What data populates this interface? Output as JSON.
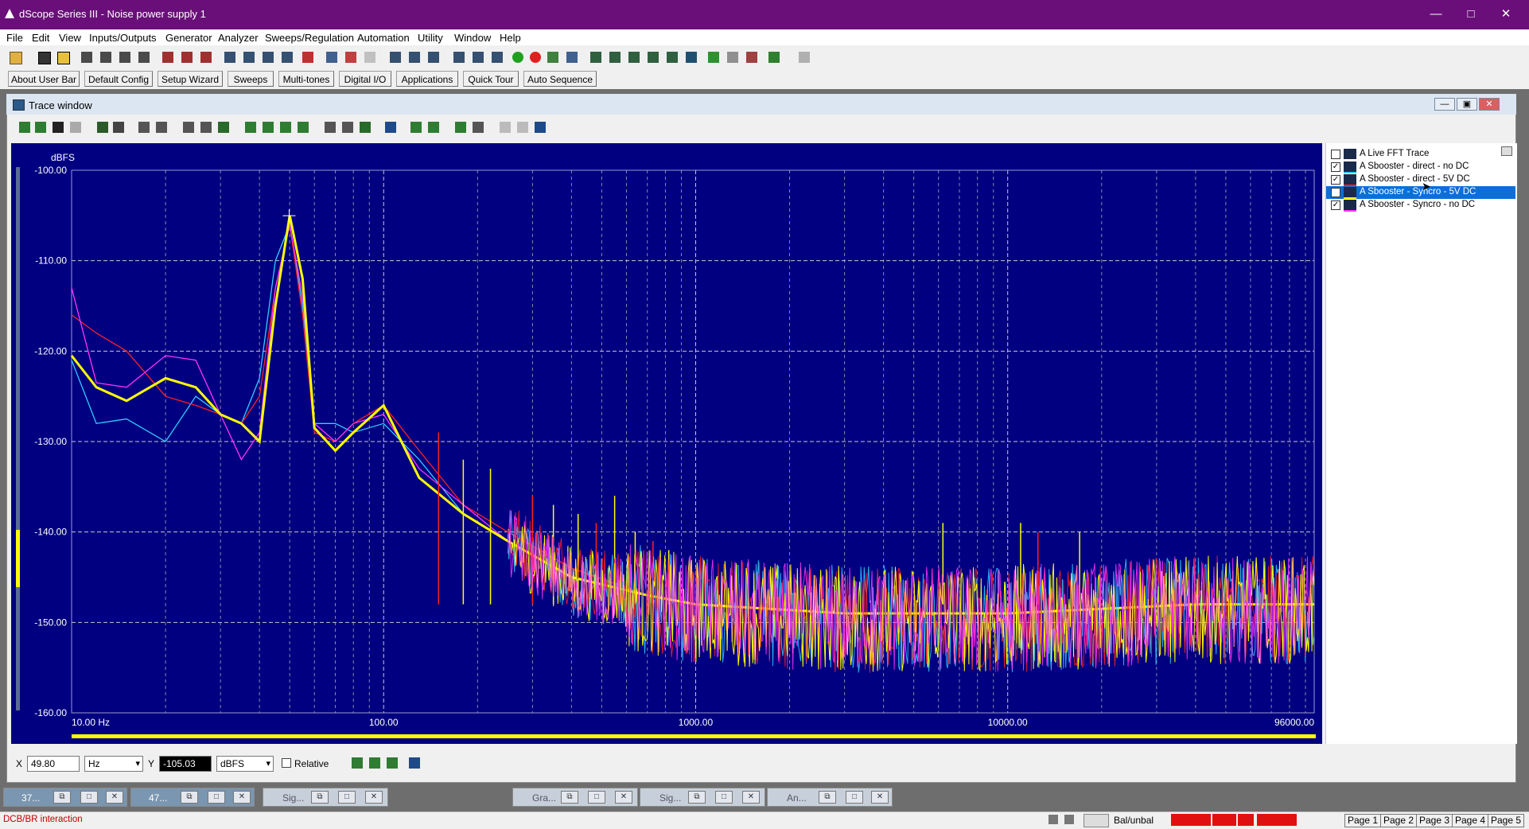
{
  "window": {
    "title": "dScope Series III - Noise power supply 1",
    "controls": [
      "—",
      "□",
      "✕"
    ]
  },
  "menu": [
    "File",
    "Edit",
    "View",
    "Inputs/Outputs",
    "Generator",
    "Analyzer",
    "Sweeps/Regulation",
    "Automation",
    "Utility",
    "Window",
    "Help"
  ],
  "userbar": [
    "About User Bar",
    "Default Config",
    "Setup Wizard",
    "Sweeps",
    "Multi-tones",
    "Digital I/O",
    "Applications",
    "Quick Tour",
    "Auto Sequence"
  ],
  "trace_window": {
    "title": "Trace window"
  },
  "legend": [
    {
      "label": "A Live FFT Trace",
      "checked": false,
      "color": "#ffffff",
      "selected": false
    },
    {
      "label": "A Sbooster - direct - no DC",
      "checked": true,
      "color": "#33ccff",
      "selected": false
    },
    {
      "label": "A Sbooster - direct - 5V DC",
      "checked": true,
      "color": "#ff2020",
      "selected": false
    },
    {
      "label": "A Sbooster - Syncro - 5V DC",
      "checked": true,
      "color": "#ffff00",
      "selected": true
    },
    {
      "label": "A Sbooster - Syncro - no DC",
      "checked": true,
      "color": "#ff33ff",
      "selected": false
    }
  ],
  "chart_data": {
    "type": "line",
    "ylabel": "dBFS",
    "xscale": "log",
    "xlim": [
      10,
      96000
    ],
    "ylim": [
      -160,
      -100
    ],
    "xticks": [
      "10.00 Hz",
      "100.00",
      "1000.00",
      "10000.00",
      "96000.00"
    ],
    "yticks": [
      "-100.00",
      "-110.00",
      "-120.00",
      "-130.00",
      "-140.00",
      "-150.00",
      "-160.00"
    ],
    "grid": true,
    "series": [
      {
        "name": "A Sbooster - direct - no DC",
        "color": "#33ccff",
        "x": [
          10,
          12,
          15,
          20,
          25,
          30,
          35,
          40,
          45,
          50,
          55,
          60,
          70,
          80,
          100,
          130,
          180,
          250,
          400,
          700,
          1000,
          3000,
          10000,
          40000,
          96000
        ],
        "y": [
          -121,
          -128,
          -127.5,
          -130,
          -125,
          -127,
          -128,
          -123,
          -110,
          -106,
          -115,
          -128,
          -128,
          -129,
          -128,
          -132,
          -138,
          -141,
          -145,
          -147,
          -148,
          -149,
          -149,
          -148,
          -148
        ]
      },
      {
        "name": "A Sbooster - direct - 5V DC",
        "color": "#ff2020",
        "x": [
          10,
          12,
          15,
          20,
          25,
          30,
          35,
          40,
          45,
          50,
          55,
          60,
          70,
          80,
          100,
          130,
          180,
          250,
          400,
          700,
          1000,
          3000,
          10000,
          40000,
          96000
        ],
        "y": [
          -116,
          -118,
          -120,
          -125,
          -126,
          -127,
          -128,
          -125,
          -113,
          -106,
          -116,
          -129,
          -130,
          -128,
          -126,
          -131,
          -137,
          -140,
          -144,
          -147,
          -148,
          -149,
          -149,
          -148,
          -148
        ]
      },
      {
        "name": "A Sbooster - Syncro - 5V DC",
        "color": "#ffff00",
        "x": [
          10,
          12,
          15,
          20,
          25,
          30,
          35,
          40,
          45,
          50,
          55,
          60,
          70,
          80,
          100,
          130,
          180,
          250,
          400,
          700,
          1000,
          3000,
          10000,
          40000,
          96000
        ],
        "y": [
          -120.5,
          -124,
          -125.5,
          -123,
          -124,
          -127,
          -128,
          -130,
          -115,
          -105,
          -112,
          -128.5,
          -131,
          -129,
          -126,
          -134,
          -138,
          -141,
          -145,
          -147,
          -148,
          -149,
          -149,
          -148,
          -148
        ]
      },
      {
        "name": "A Sbooster - Syncro - no DC",
        "color": "#ff33ff",
        "x": [
          10,
          12,
          15,
          20,
          25,
          30,
          35,
          40,
          45,
          50,
          55,
          60,
          70,
          80,
          100,
          130,
          180,
          250,
          400,
          700,
          1000,
          3000,
          10000,
          40000,
          96000
        ],
        "y": [
          -113,
          -123.5,
          -124,
          -120.5,
          -121,
          -127,
          -132,
          -129,
          -113,
          -106,
          -114,
          -128,
          -130,
          -128,
          -127,
          -133,
          -137,
          -141,
          -145,
          -147,
          -148,
          -149,
          -149,
          -148,
          -148
        ]
      }
    ],
    "markers": [
      {
        "x": 49.8,
        "y": -105.03
      }
    ]
  },
  "cursor": {
    "x_label": "X",
    "x_value": "49.80",
    "x_unit": "Hz",
    "y_label": "Y",
    "y_value": "-105.03",
    "y_unit": "dBFS",
    "relative_label": "Relative"
  },
  "minimized": [
    "37...",
    "47...",
    "Sig...",
    "Gra...",
    "Sig...",
    "An..."
  ],
  "status": {
    "left": "DCB/BR interaction",
    "conn": "Bal/unbal",
    "pages": [
      "Page 1",
      "Page 2",
      "Page 3",
      "Page 4",
      "Page 5"
    ]
  }
}
